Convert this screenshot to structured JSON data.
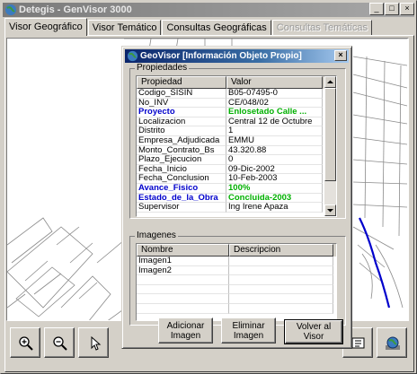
{
  "window": {
    "title": "Detegis - GenVisor 3000",
    "buttons": {
      "minimize": "_",
      "maximize": "□",
      "close": "×"
    }
  },
  "tabs": [
    {
      "label": "Visor Geográfico",
      "active": true,
      "enabled": true
    },
    {
      "label": "Visor Temático",
      "active": false,
      "enabled": true
    },
    {
      "label": "Consultas Geográficas",
      "active": false,
      "enabled": true
    },
    {
      "label": "Consultas Temáticas",
      "active": false,
      "enabled": false
    }
  ],
  "toolbar": {
    "icons": [
      "zoom-in-icon",
      "zoom-out-icon",
      "pointer-icon",
      "info-icon",
      "globe-icon"
    ]
  },
  "dialog": {
    "title": "GeoVisor [Información Objeto Propio]",
    "close": "×",
    "properties_group": "Propiedades",
    "properties_columns": [
      "Propiedad",
      "Valor"
    ],
    "properties_rows": [
      {
        "prop": "Codigo_SISIN",
        "value": "B05-07495-0",
        "style": "normal"
      },
      {
        "prop": "No_INV",
        "value": "CE/048/02",
        "style": "normal"
      },
      {
        "prop": "Proyecto",
        "value": "Enlosetado Calle ...",
        "style": "highlight"
      },
      {
        "prop": "Localizacion",
        "value": "Central 12 de Octubre",
        "style": "normal"
      },
      {
        "prop": "Distrito",
        "value": "1",
        "style": "normal"
      },
      {
        "prop": "Empresa_Adjudicada",
        "value": "EMMU",
        "style": "normal"
      },
      {
        "prop": "Monto_Contrato_Bs",
        "value": "43.320.88",
        "style": "normal"
      },
      {
        "prop": "Plazo_Ejecucion",
        "value": "0",
        "style": "normal"
      },
      {
        "prop": "Fecha_Inicio",
        "value": "09-Dic-2002",
        "style": "normal"
      },
      {
        "prop": "Fecha_Conclusion",
        "value": "10-Feb-2003",
        "style": "normal"
      },
      {
        "prop": "Avance_Fisico",
        "value": "100%",
        "style": "highlight"
      },
      {
        "prop": "Estado_de_la_Obra",
        "value": "Concluida-2003",
        "style": "highlight"
      },
      {
        "prop": "Supervisor",
        "value": "Ing Irene Apaza",
        "style": "normal"
      }
    ],
    "images_group": "Imagenes",
    "images_columns": [
      "Nombre",
      "Descripcion"
    ],
    "images_rows": [
      {
        "name": "Imagen1",
        "desc": ""
      },
      {
        "name": "Imagen2",
        "desc": ""
      }
    ],
    "buttons": {
      "add": {
        "line1": "Adicionar",
        "line2": "Imagen"
      },
      "remove": {
        "line1": "Eliminar",
        "line2": "Imagen"
      },
      "back": "Volver al Visor"
    }
  },
  "colors": {
    "prop_highlight": "#0000cc",
    "value_highlight": "#00b000",
    "title_active": "#0a246a",
    "map_road": "#0000cc"
  }
}
